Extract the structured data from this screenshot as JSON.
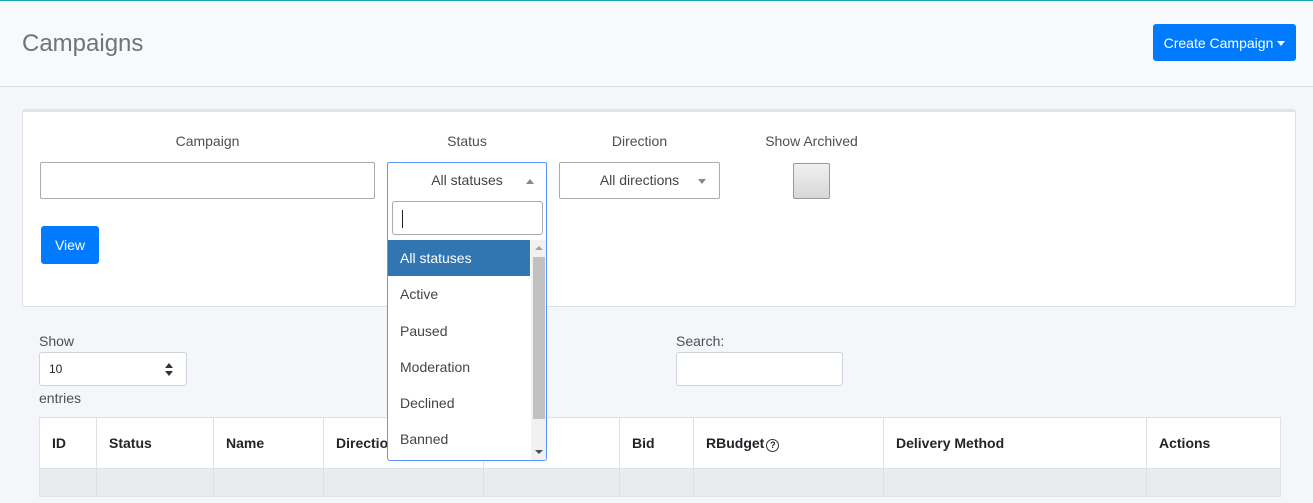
{
  "header": {
    "title": "Campaigns",
    "create_button": "Create Campaign"
  },
  "filters": {
    "campaign_label": "Campaign",
    "campaign_value": "",
    "status_label": "Status",
    "status_selected": "All statuses",
    "direction_label": "Direction",
    "direction_selected": "All directions",
    "archived_label": "Show Archived",
    "view_button": "View"
  },
  "status_dropdown": {
    "search_value": "",
    "options": [
      "All statuses",
      "Active",
      "Paused",
      "Moderation",
      "Declined",
      "Banned"
    ],
    "highlighted": "All statuses"
  },
  "table_controls": {
    "show_label": "Show",
    "entries_value": "10",
    "entries_label": "entries",
    "search_label": "Search:",
    "search_value": ""
  },
  "table": {
    "columns": [
      "ID",
      "Status",
      "Name",
      "Directio",
      "",
      "Bid",
      "RBudget",
      "Delivery Method",
      "Actions"
    ],
    "rbudget_icon": "question-circle-icon"
  },
  "colors": {
    "primary": "#007bff",
    "highlight": "#3276b1",
    "accent_line": "#17a2b8"
  }
}
